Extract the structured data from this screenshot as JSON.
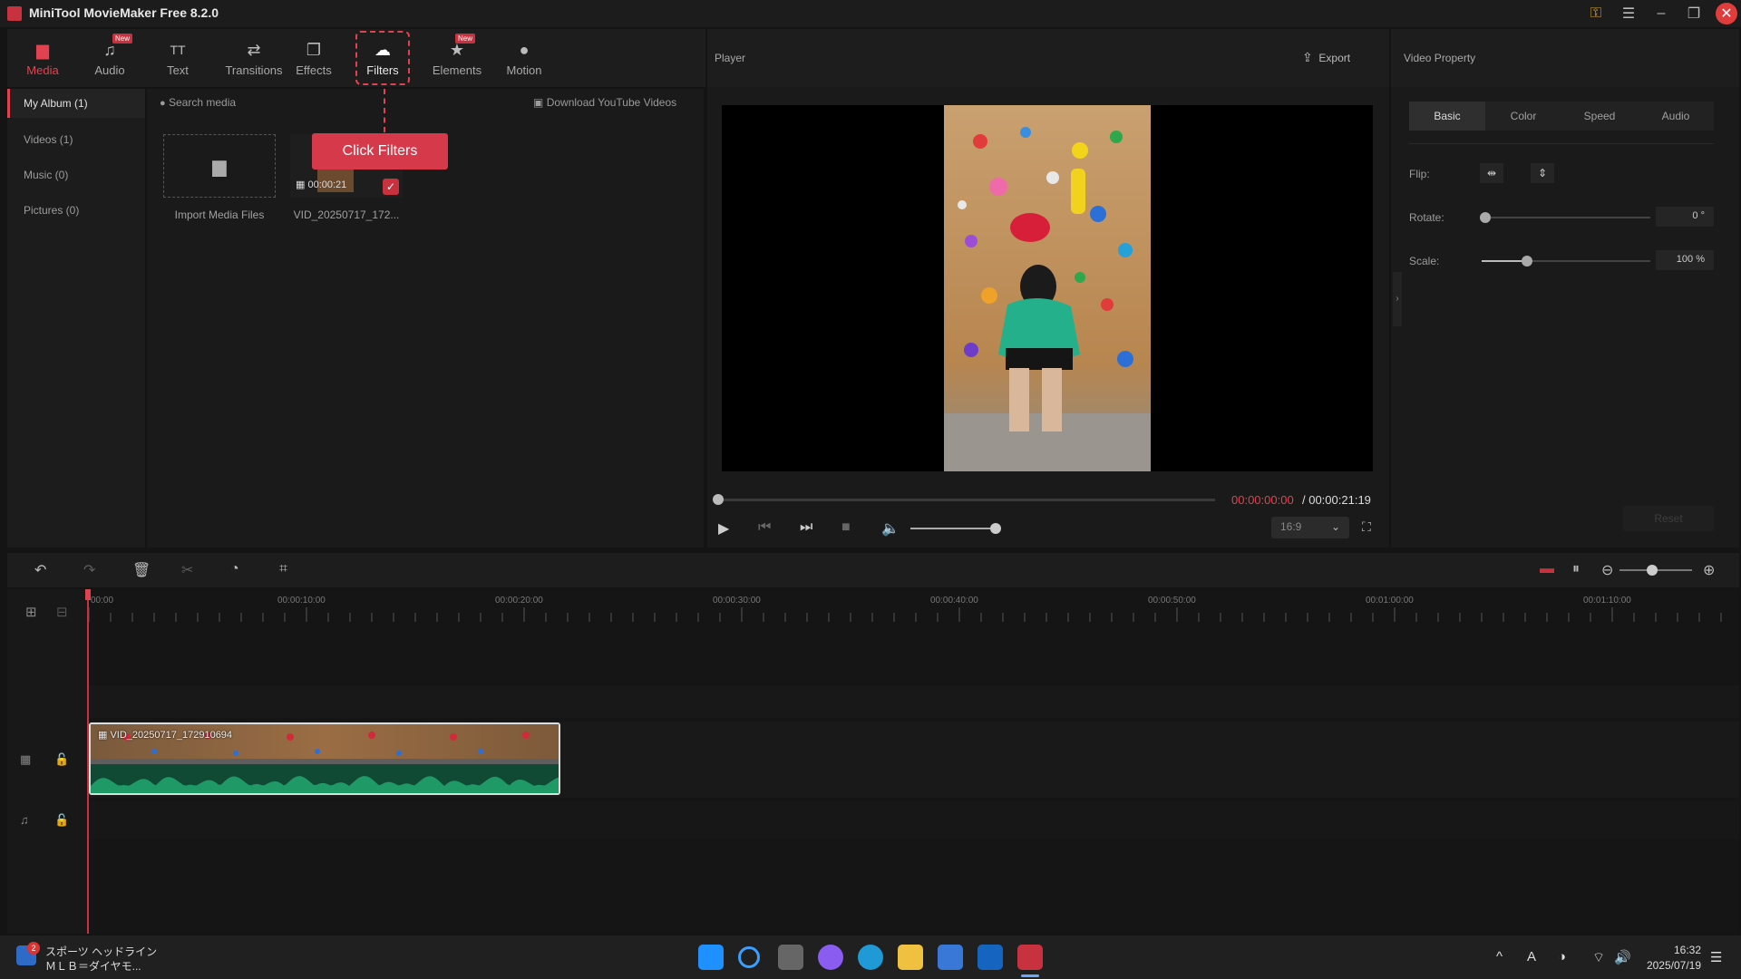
{
  "window": {
    "title": "MiniTool MovieMaker Free 8.2.0"
  },
  "toolbar": {
    "items": [
      {
        "label": "Media",
        "icon": "folder-icon",
        "glyph": "▆"
      },
      {
        "label": "Audio",
        "icon": "music-note-icon",
        "glyph": "♫",
        "badge": "New"
      },
      {
        "label": "Text",
        "icon": "text-icon",
        "glyph": "TT"
      },
      {
        "label": "Transitions",
        "icon": "arrows-swap-icon",
        "glyph": "⇄"
      },
      {
        "label": "Effects",
        "icon": "layers-icon",
        "glyph": "❐"
      },
      {
        "label": "Filters",
        "icon": "cloud-filter-icon",
        "glyph": "☁"
      },
      {
        "label": "Elements",
        "icon": "star-elements-icon",
        "glyph": "★"
      },
      {
        "label": "Motion",
        "icon": "motion-ball-icon",
        "glyph": "●"
      }
    ],
    "elements_badge": "New"
  },
  "tooltip": {
    "text": "Click Filters"
  },
  "left_nav": {
    "items": [
      "My Album (1)",
      "Videos (1)",
      "Music (0)",
      "Pictures (0)"
    ]
  },
  "media": {
    "search_placeholder": "Search media",
    "download_label": "Download YouTube Videos",
    "import_label": "Import Media Files",
    "clip_label": "VID_20250717_172...",
    "clip_duration": "00:00:21"
  },
  "player": {
    "title": "Player",
    "export_label": "Export",
    "time_current": "00:00:00:00",
    "time_total": "/ 00:00:21:19",
    "aspect_ratio": "16:9",
    "progress": 0,
    "volume": 0.95
  },
  "video_property": {
    "title": "Video Property",
    "tabs": [
      "Basic",
      "Color",
      "Speed",
      "Audio"
    ],
    "flip_label": "Flip:",
    "rotate_label": "Rotate:",
    "rotate_value": "0 °",
    "scale_label": "Scale:",
    "scale_value": "100 %",
    "reset_label": "Reset"
  },
  "timeline": {
    "ticks": [
      "00:00",
      "00:00:10:00",
      "00:00:20:00",
      "00:00:30:00",
      "00:00:40:00",
      "00:00:50:00",
      "00:01:00:00",
      "00:01:10:00"
    ],
    "clip_name": "VID_20250717_172910694"
  },
  "taskbar": {
    "news_line1": "スポーツ ヘッドライン",
    "news_line2": "ＭＬＢ＝ダイヤモ...",
    "news_badge": "2",
    "time": "16:32",
    "date": "2025/07/19"
  },
  "colors": {
    "accent": "#e0434f",
    "panel": "#1a1a1a",
    "waveform": "#104a35"
  }
}
